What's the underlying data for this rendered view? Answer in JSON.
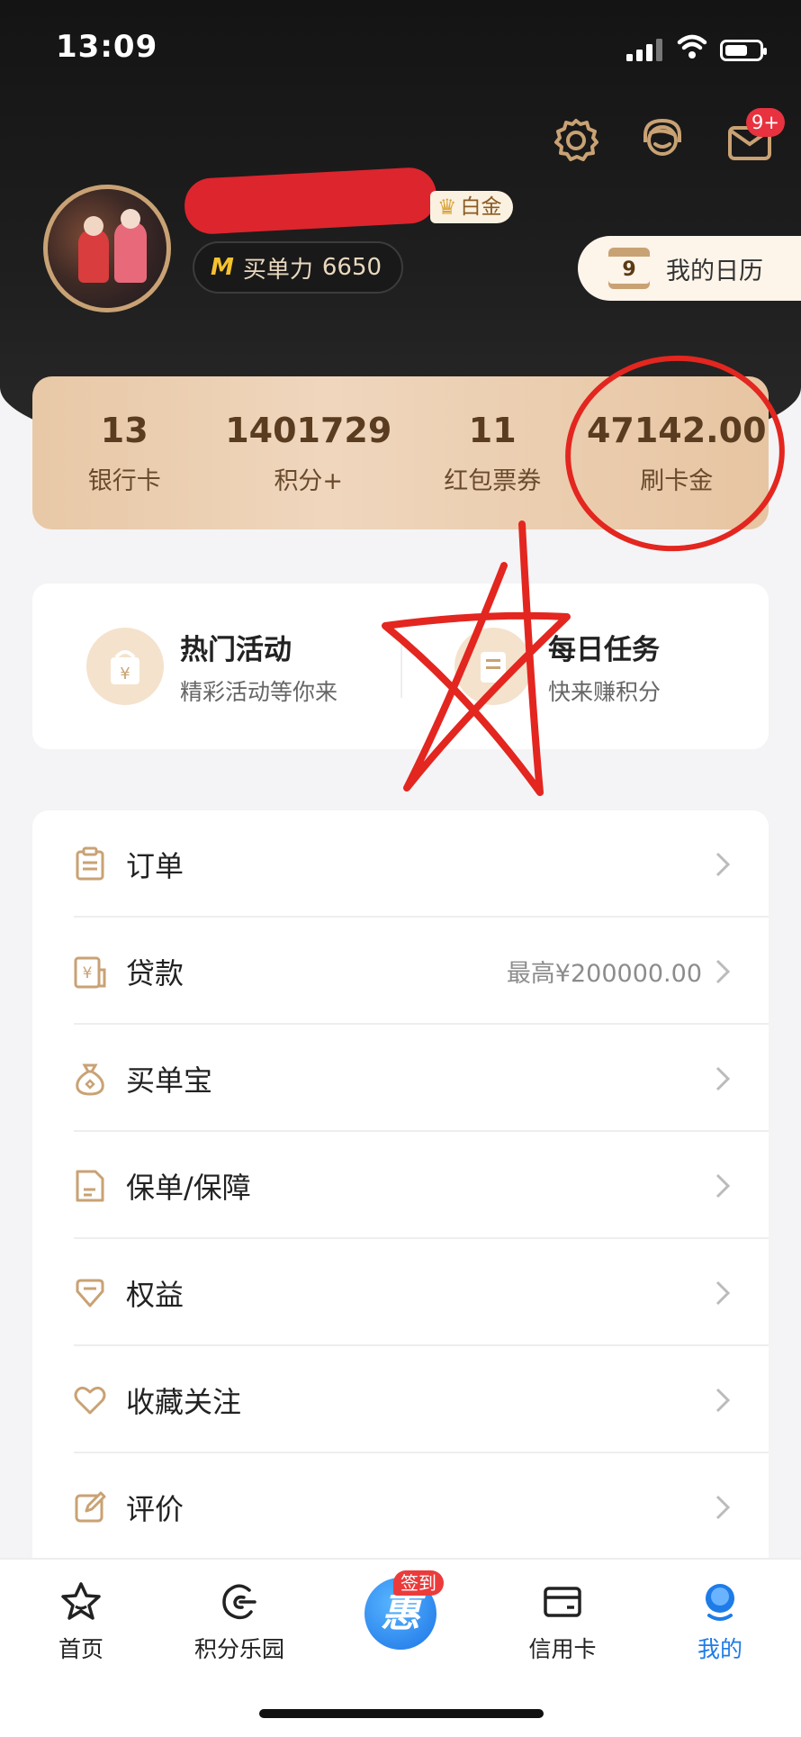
{
  "status_bar": {
    "time": "13:09"
  },
  "header": {
    "message_badge": "9+",
    "member_level": "白金",
    "buy_power_label": "买单力",
    "buy_power_value": "6650",
    "calendar_day": "9",
    "calendar_label": "我的日历"
  },
  "stats": [
    {
      "value": "13",
      "label": "银行卡"
    },
    {
      "value": "1401729",
      "label": "积分+"
    },
    {
      "value": "11",
      "label": "红包票券"
    },
    {
      "value": "47142.00",
      "label": "刷卡金"
    }
  ],
  "promos": [
    {
      "title": "热门活动",
      "subtitle": "精彩活动等你来",
      "icon": "gift-bag-icon"
    },
    {
      "title": "每日任务",
      "subtitle": "快来赚积分",
      "icon": "task-icon"
    }
  ],
  "menu": [
    {
      "label": "订单",
      "extra": "",
      "icon": "order-icon"
    },
    {
      "label": "贷款",
      "extra": "最高¥200000.00",
      "icon": "loan-icon"
    },
    {
      "label": "买单宝",
      "extra": "",
      "icon": "money-bag-icon"
    },
    {
      "label": "保单/保障",
      "extra": "",
      "icon": "policy-icon"
    },
    {
      "label": "权益",
      "extra": "",
      "icon": "diamond-icon"
    },
    {
      "label": "收藏关注",
      "extra": "",
      "icon": "heart-icon"
    },
    {
      "label": "评价",
      "extra": "",
      "icon": "edit-icon"
    }
  ],
  "tabbar": {
    "items": [
      {
        "label": "首页",
        "icon": "star-icon"
      },
      {
        "label": "积分乐园",
        "icon": "points-icon"
      },
      {
        "label": "",
        "icon": "checkin-icon"
      },
      {
        "label": "信用卡",
        "icon": "card-icon"
      },
      {
        "label": "我的",
        "icon": "profile-icon"
      }
    ],
    "center_glyph": "惠",
    "center_tag": "签到"
  },
  "colors": {
    "accent_gold": "#c9a274",
    "active_blue": "#1e7ce8",
    "badge_red": "#e8323f"
  }
}
